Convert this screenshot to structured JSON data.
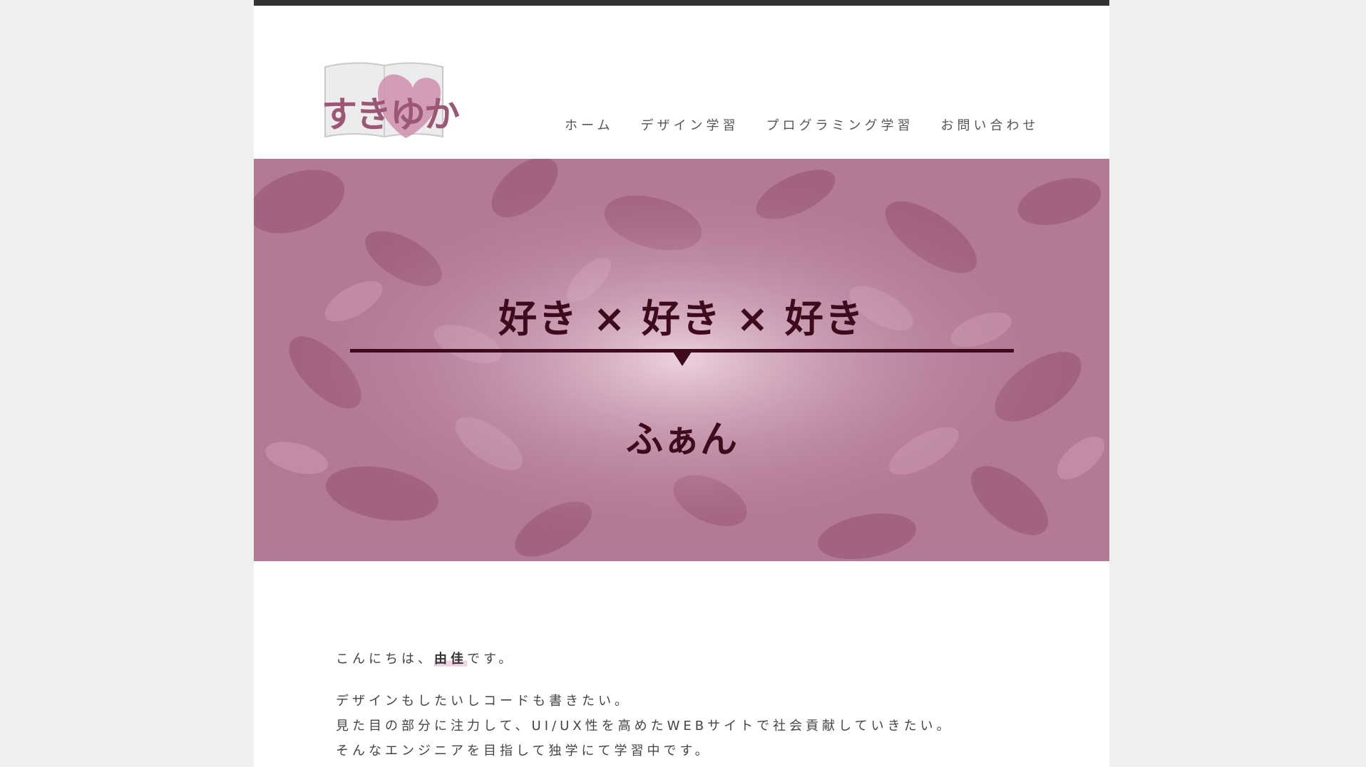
{
  "header": {
    "logo_text": "すきゆか"
  },
  "nav": [
    {
      "label": "ホーム"
    },
    {
      "label": "デザイン学習"
    },
    {
      "label": "プログラミング学習"
    },
    {
      "label": "お問い合わせ"
    }
  ],
  "hero": {
    "headline": "好き × 好き × 好き",
    "sub": "ふぁん"
  },
  "intro": {
    "greeting_before": "こんにちは、",
    "name": "由佳",
    "greeting_after": "です。",
    "lines": [
      "デザインもしたいしコードも書きたい。",
      "見た目の部分に注力して、UI/UX性を高めたWEBサイトで社会貢献していきたい。",
      "そんなエンジニアを目指して独学にて学習中です。"
    ]
  },
  "colors": {
    "accent": "#9c5676",
    "hero_bg": "#b37a96",
    "hero_text": "#3e0a1c",
    "top_bar": "#333333"
  }
}
